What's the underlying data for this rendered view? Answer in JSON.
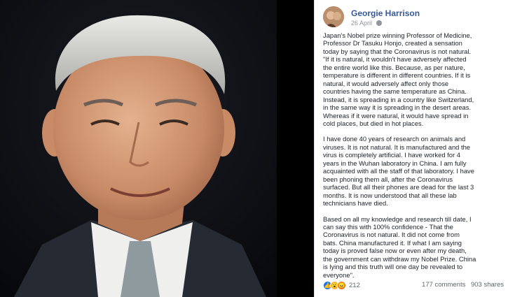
{
  "post": {
    "author": "Georgie Harrison",
    "timestamp": "26 April",
    "paragraphs": [
      "Japan's Nobel prize winning Professor of Medicine,\nProfessor Dr Tasuku Honjo, created a sensation\ntoday by saying that the Coronavirus is not natural.\n\"If it is natural, it wouldn't have adversely affected\nthe entire world like this. Because, as per nature,\ntemperature is different in different countries. If it is\nnatural, it would adversely affect only those\ncountries having the same temperature as China.\nInstead, it is spreading in a country like Switzerland,\nin the same way it is spreading in the desert areas.\nWhereas if it were natural, it would have spread in\ncold places, but died in hot places.",
      "I have done 40 years of research on animals and\nviruses. It is not natural. It is manufactured and the\nvirus is completely artificial. I have worked for 4\nyears in the Wuhan laboratory in China. I am fully\nacquainted with all the staff of that laboratory. I have\nbeen phoning them all, after the Coronavirus\nsurfaced. But all their phones are dead for the last 3\nmonths. It is now understood that all these lab\ntechnicians have died.",
      "Based on all my knowledge and research till date, I\ncan say this with 100% confidence - That the\nCoronavirus is not natural. It did not come from\nbats. China manufactured it. If what I am saying\ntoday is proved false now or even after my death,\nthe government can withdraw my Nobel Prize. China\nis lying and this truth will one day be revealed to\neveryone\"."
    ],
    "reactions": {
      "icons": [
        "like-icon",
        "wow-icon",
        "angry-icon"
      ],
      "count": "212"
    },
    "comments": "177 comments",
    "shares": "903 shares"
  },
  "colors": {
    "author_link": "#385898",
    "meta_gray": "#90949c",
    "like_blue": "#1877f2"
  }
}
